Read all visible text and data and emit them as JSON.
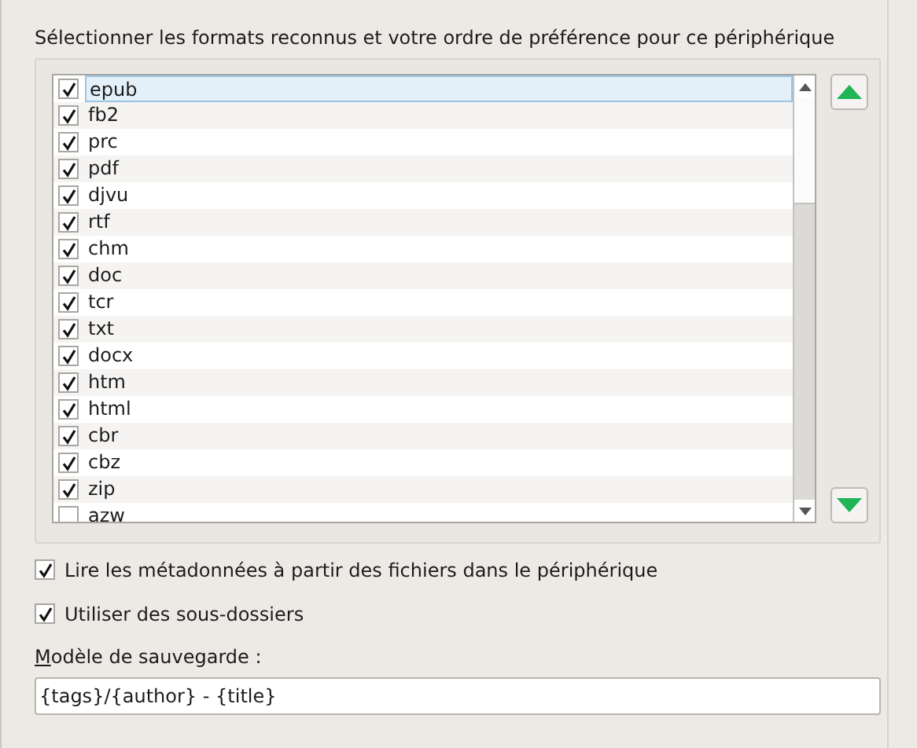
{
  "heading": "Sélectionner les formats reconnus et votre ordre de préférence pour ce périphérique",
  "formats": [
    {
      "label": "epub",
      "checked": true,
      "selected": true
    },
    {
      "label": "fb2",
      "checked": true,
      "selected": false
    },
    {
      "label": "prc",
      "checked": true,
      "selected": false
    },
    {
      "label": "pdf",
      "checked": true,
      "selected": false
    },
    {
      "label": "djvu",
      "checked": true,
      "selected": false
    },
    {
      "label": "rtf",
      "checked": true,
      "selected": false
    },
    {
      "label": "chm",
      "checked": true,
      "selected": false
    },
    {
      "label": "doc",
      "checked": true,
      "selected": false
    },
    {
      "label": "tcr",
      "checked": true,
      "selected": false
    },
    {
      "label": "txt",
      "checked": true,
      "selected": false
    },
    {
      "label": "docx",
      "checked": true,
      "selected": false
    },
    {
      "label": "htm",
      "checked": true,
      "selected": false
    },
    {
      "label": "html",
      "checked": true,
      "selected": false
    },
    {
      "label": "cbr",
      "checked": true,
      "selected": false
    },
    {
      "label": "cbz",
      "checked": true,
      "selected": false
    },
    {
      "label": "zip",
      "checked": true,
      "selected": false
    },
    {
      "label": "azw",
      "checked": false,
      "selected": false
    }
  ],
  "options": [
    {
      "label": "Lire les métadonnées à partir des fichiers dans le périphérique",
      "checked": true
    },
    {
      "label": "Utiliser des sous-dossiers",
      "checked": true
    }
  ],
  "save_template": {
    "label": "Modèle de sauvegarde :",
    "mnemonic_underlined": true,
    "value": "{tags}/{author} - {title}"
  }
}
